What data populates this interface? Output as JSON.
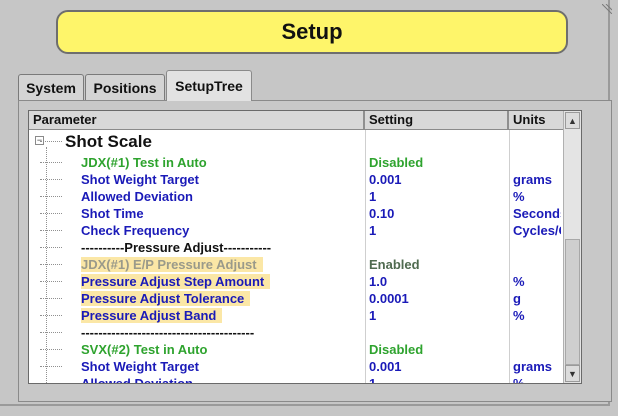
{
  "title": "Setup",
  "tabs": [
    {
      "label": "System",
      "active": false
    },
    {
      "label": "Positions",
      "active": false
    },
    {
      "label": "SetupTree",
      "active": true
    }
  ],
  "table": {
    "headers": {
      "parameter": "Parameter",
      "setting": "Setting",
      "units": "Units"
    },
    "group_label": "Shot Scale",
    "rows": [
      {
        "param": "JDX(#1) Test in Auto",
        "setting": "Disabled",
        "units": "",
        "color": "green"
      },
      {
        "param": "Shot Weight Target",
        "setting": "0.001",
        "units": "grams",
        "color": "blue"
      },
      {
        "param": "Allowed Deviation",
        "setting": "1",
        "units": "%",
        "color": "blue"
      },
      {
        "param": "Shot Time",
        "setting": "0.10",
        "units": "Seconds",
        "color": "blue"
      },
      {
        "param": "Check Frequency",
        "setting": "1",
        "units": "Cycles/Cl",
        "color": "blue"
      },
      {
        "param": "----------Pressure Adjust-----------",
        "setting": "",
        "units": "",
        "color": "dark"
      },
      {
        "param": "JDX(#1) E/P Pressure Adjust",
        "setting": "Enabled",
        "units": "",
        "color": "gray",
        "highlight": true
      },
      {
        "param": "Pressure Adjust Step Amount",
        "setting": "1.0",
        "units": "%",
        "color": "blue",
        "highlight": true
      },
      {
        "param": "Pressure Adjust Tolerance",
        "setting": "0.0001",
        "units": "g",
        "color": "blue",
        "highlight": true
      },
      {
        "param": "Pressure Adjust Band",
        "setting": "1",
        "units": "%",
        "color": "blue",
        "highlight": true
      },
      {
        "param": "----------------------------------------",
        "setting": "",
        "units": "",
        "color": "dark"
      },
      {
        "param": "SVX(#2) Test in Auto",
        "setting": "Disabled",
        "units": "",
        "color": "green"
      },
      {
        "param": "Shot Weight Target",
        "setting": "0.001",
        "units": "grams",
        "color": "blue"
      },
      {
        "param": "Allowed Deviation",
        "setting": "1",
        "units": "%",
        "color": "blue"
      }
    ]
  },
  "icons": {
    "collapse": "minus-box-icon",
    "scroll_up": "triangle-up-icon",
    "scroll_down": "triangle-down-icon"
  },
  "colors": {
    "title_bg": "#fef56a",
    "highlight": "#fbe7a6",
    "blue_text": "#1a1ab8",
    "green_text": "#2ea32e"
  }
}
